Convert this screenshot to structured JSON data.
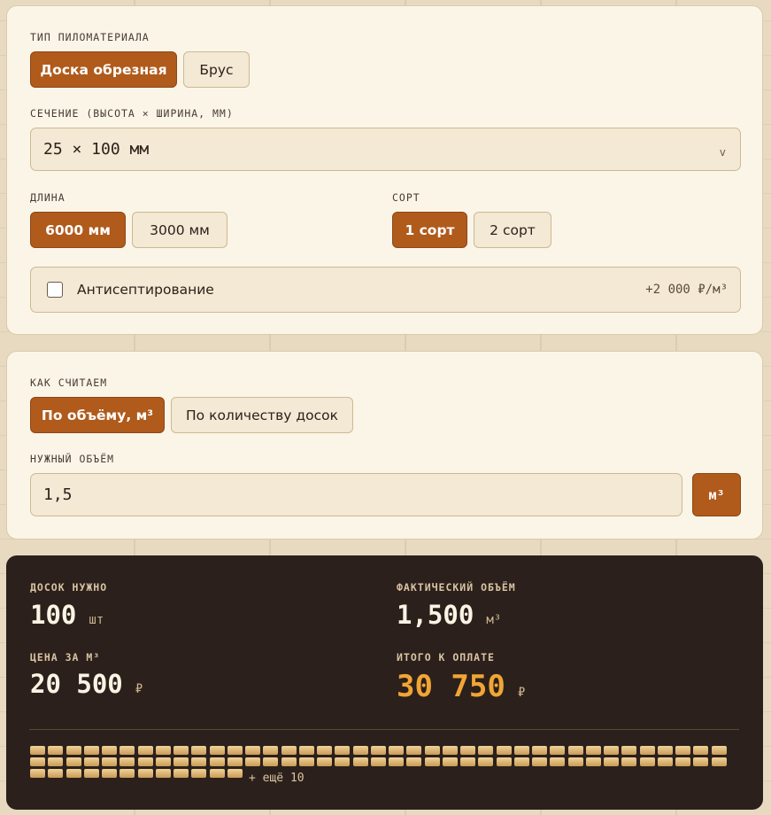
{
  "lumber": {
    "type_label": "ТИП ПИЛОМАТЕРИАЛА",
    "types": [
      "Доска обрезная",
      "Брус"
    ],
    "section_label": "СЕЧЕНИЕ (ВЫСОТА × ШИРИНА, ММ)",
    "section_value": "25 × 100 мм",
    "section_chevron": "v",
    "length_label": "ДЛИНА",
    "lengths": [
      "6000 мм",
      "3000 мм"
    ],
    "grade_label": "СОРТ",
    "grades": [
      "1 сорт",
      "2 сорт"
    ],
    "antiseptic_label": "Антисептирование",
    "antiseptic_price": "+2 000 ₽/м³",
    "antiseptic_checked": false
  },
  "calc": {
    "mode_label": "КАК СЧИТАЕМ",
    "modes": [
      "По объёму, м³",
      "По количеству досок"
    ],
    "volume_label": "НУЖНЫЙ ОБЪЁМ",
    "volume_value": "1,5",
    "volume_unit": "м³"
  },
  "result": {
    "boards_label": "ДОСОК НУЖНО",
    "boards_value": "100",
    "boards_unit": "шт",
    "volume_label": "ФАКТИЧЕСКИЙ ОБЪЁМ",
    "volume_value": "1,500",
    "volume_unit": "м³",
    "price_label": "ЦЕНА ЗА М³",
    "price_value": "20 500",
    "price_unit": "₽",
    "total_label": "ИТОГО К ОПЛАТЕ",
    "total_value": "30 750",
    "total_unit": "₽",
    "boards_shown": 90,
    "more_text": "+ ещё 10"
  },
  "colors": {
    "accent": "#b05a1c",
    "total": "#f0a535",
    "dark_panel": "#2b201b"
  }
}
